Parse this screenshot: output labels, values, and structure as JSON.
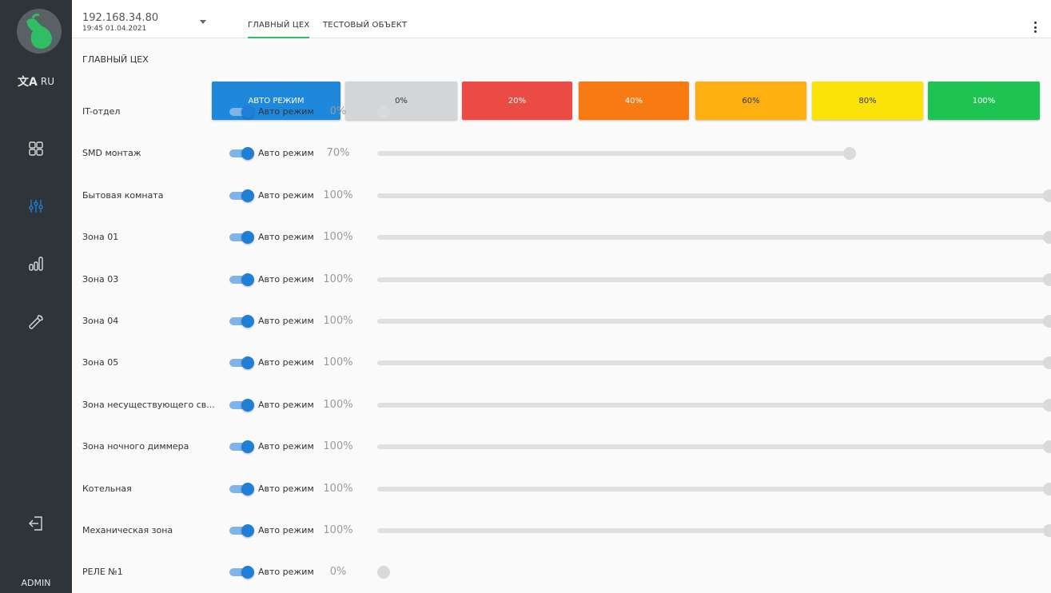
{
  "sidebar": {
    "lang_icon": "translate-icon",
    "lang_label": "RU",
    "user": "ADMIN",
    "nav": [
      {
        "id": "dashboard",
        "icon": "grid-icon"
      },
      {
        "id": "control",
        "icon": "sliders-icon",
        "active": true
      },
      {
        "id": "stats",
        "icon": "bar-chart-icon"
      },
      {
        "id": "settings",
        "icon": "wrench-icon"
      },
      {
        "id": "logout",
        "icon": "logout-icon"
      }
    ],
    "colors": {
      "background": "#2e3538",
      "active": "#1f7fd6"
    }
  },
  "header": {
    "device_ip": "192.168.34.80",
    "device_time": "19:45 01.04.2021",
    "tabs": [
      {
        "label": "ГЛАВНЫЙ ЦЕХ",
        "active": true
      },
      {
        "label": "ТЕСТОВЫЙ ОБЪЕКТ",
        "active": false
      }
    ],
    "menu_icon": "more-vertical-icon"
  },
  "main": {
    "group_title": "ГЛАВНЫЙ ЦЕХ",
    "presets": [
      {
        "label": "АВТО РЕЖИМ",
        "color": "#1e88dc",
        "text_color": "#ffffff"
      },
      {
        "label": "0%",
        "color": "#d3d6d9",
        "text_color": "#333333"
      },
      {
        "label": "20%",
        "color": "#ea4b45",
        "text_color": "#ffffff"
      },
      {
        "label": "40%",
        "color": "#f77b12",
        "text_color": "#ffffff"
      },
      {
        "label": "60%",
        "color": "#fdb00f",
        "text_color": "#333333"
      },
      {
        "label": "80%",
        "color": "#fbe30a",
        "text_color": "#333333"
      },
      {
        "label": "100%",
        "color": "#1ec451",
        "text_color": "#ffffff"
      }
    ],
    "auto_label": "Авто режим",
    "zones": [
      {
        "name": "IT-отдел",
        "level": "0%",
        "value": 0
      },
      {
        "name": "SMD монтаж",
        "level": "70%",
        "value": 70
      },
      {
        "name": "Бытовая комната",
        "level": "100%",
        "value": 100
      },
      {
        "name": "Зона 01",
        "level": "100%",
        "value": 100
      },
      {
        "name": "Зона 03",
        "level": "100%",
        "value": 100
      },
      {
        "name": "Зона 04",
        "level": "100%",
        "value": 100
      },
      {
        "name": "Зона 05",
        "level": "100%",
        "value": 100
      },
      {
        "name": "Зона несуществующего св...",
        "level": "100%",
        "value": 100
      },
      {
        "name": "Зона ночного диммера",
        "level": "100%",
        "value": 100
      },
      {
        "name": "Котельная",
        "level": "100%",
        "value": 100
      },
      {
        "name": "Механическая зона",
        "level": "100%",
        "value": 100
      },
      {
        "name": "РЕЛЕ №1",
        "level": "0%",
        "value": 0
      }
    ]
  }
}
